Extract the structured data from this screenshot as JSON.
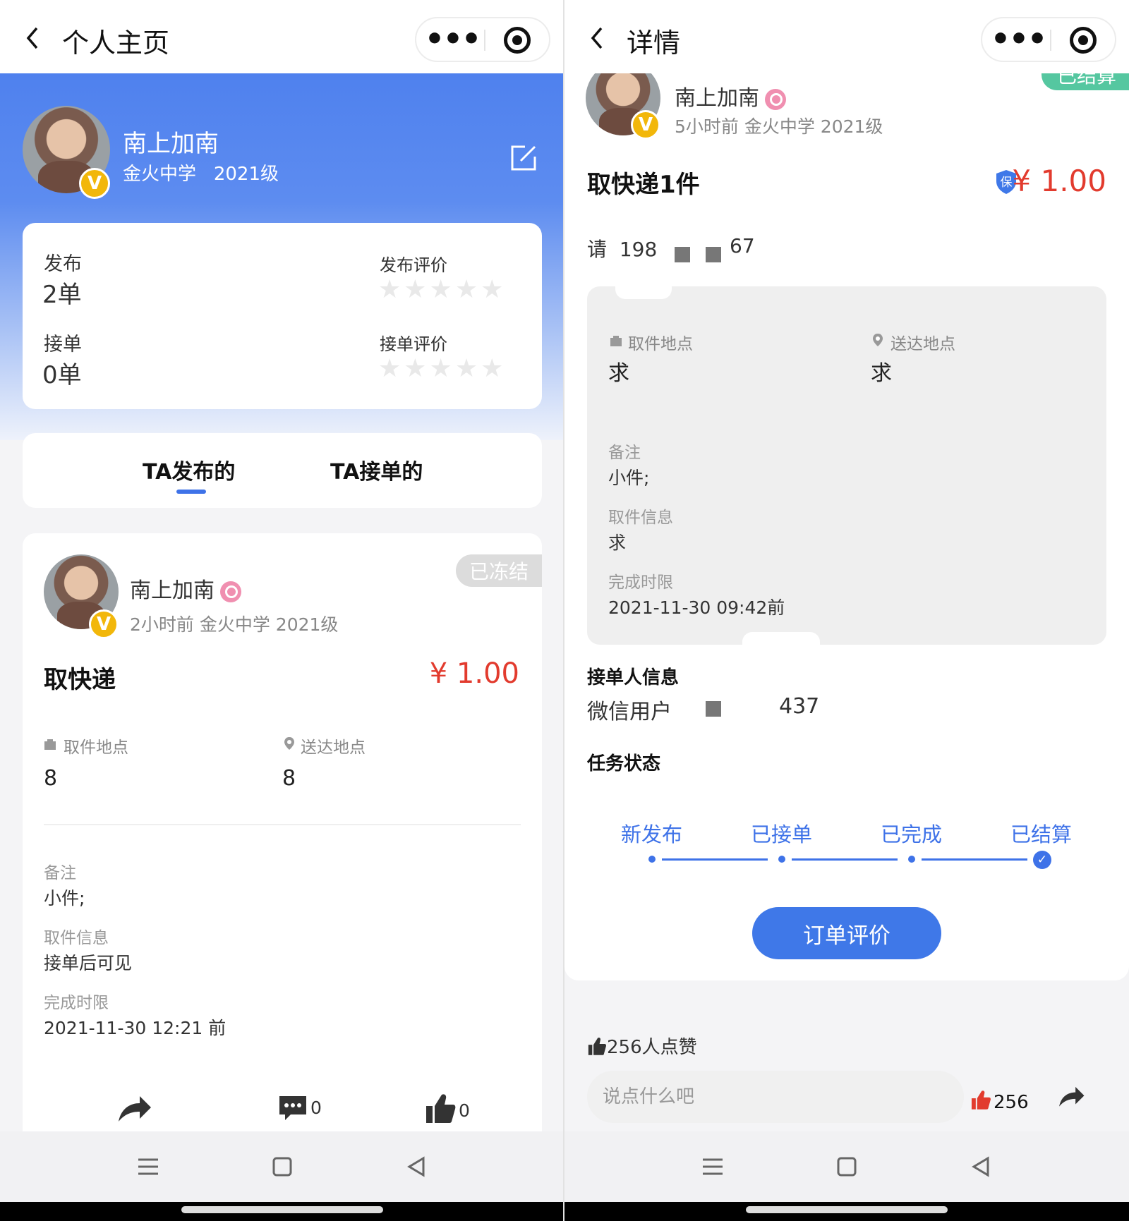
{
  "left": {
    "nav": {
      "title": "个人主页"
    },
    "profile": {
      "name": "南上加南",
      "school": "金火中学",
      "grade": "2021级",
      "badge": "V"
    },
    "stats": {
      "publish_label": "发布",
      "publish_value": "2单",
      "publish_rating_label": "发布评价",
      "accept_label": "接单",
      "accept_value": "0单",
      "accept_rating_label": "接单评价",
      "publish_stars": 0,
      "accept_stars": 0
    },
    "tabs": [
      "TA发布的",
      "TA接单的"
    ],
    "active_tab": 0,
    "card": {
      "status": "已冻结",
      "name": "南上加南",
      "meta": "2小时前 金火中学 2021级",
      "badge": "V",
      "title": "取快递",
      "price": "¥ 1.00",
      "pickup_label": "取件地点",
      "pickup_value": "8",
      "delivery_label": "送达地点",
      "delivery_value": "8",
      "note_label": "备注",
      "note_value": "小件;",
      "info_label": "取件信息",
      "info_value": "接单后可见",
      "deadline_label": "完成时限",
      "deadline_value": "2021-11-30 12:21 前",
      "comment_count": "0",
      "like_count": "0"
    }
  },
  "right": {
    "nav": {
      "title": "详情"
    },
    "header": {
      "name": "南上加南",
      "meta": "5小时前 金火中学 2021级",
      "badge": "V",
      "status": "已结算"
    },
    "task_title": "取快递1件",
    "insured_badge": "保",
    "price": "¥ 1.00",
    "phone_prefix": "请",
    "phone_start": "198",
    "phone_end": "67",
    "info": {
      "pickup_label": "取件地点",
      "pickup_value": "求",
      "delivery_label": "送达地点",
      "delivery_value": "求",
      "note_label": "备注",
      "note_value": "小件;",
      "info_label": "取件信息",
      "info_value": "求",
      "deadline_label": "完成时限",
      "deadline_value": "2021-11-30 09:42前"
    },
    "acceptor_title": "接单人信息",
    "acceptor_name": "微信用户",
    "acceptor_suffix": "437",
    "status_title": "任务状态",
    "steps": [
      "新发布",
      "已接单",
      "已完成",
      "已结算"
    ],
    "current_step": 3,
    "rate_button": "订单评价",
    "likes_text": "256人点赞",
    "comment_placeholder": "说点什么吧",
    "like_count": "256"
  },
  "colors": {
    "primary": "#3f78e8",
    "price": "#e23b2e",
    "settled": "#55c7a0",
    "vip": "#f2b70a"
  }
}
